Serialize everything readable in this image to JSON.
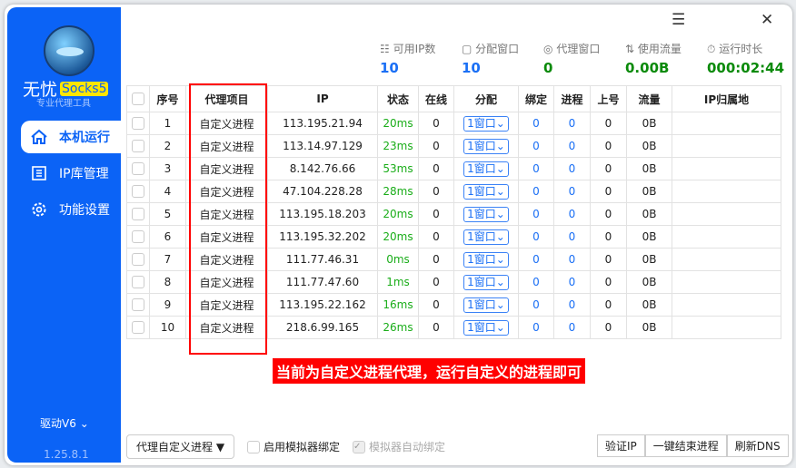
{
  "sidebar": {
    "brand": "无忧",
    "brand_tag": "Socks5",
    "subtitle": "专业代理工具",
    "items": [
      {
        "label": "本机运行",
        "icon": "home-icon"
      },
      {
        "label": "IP库管理",
        "icon": "list-icon"
      },
      {
        "label": "功能设置",
        "icon": "gear-icon"
      }
    ],
    "driver": "驱动V6",
    "version": "1.25.8.1"
  },
  "stats": [
    {
      "label": "可用IP数",
      "value": "10",
      "color": "#1a6ff5",
      "icon": "list-icon"
    },
    {
      "label": "分配窗口",
      "value": "10",
      "color": "#1a6ff5",
      "icon": "window-icon"
    },
    {
      "label": "代理窗口",
      "value": "0",
      "color": "#0a8a0a",
      "icon": "proxy-icon"
    },
    {
      "label": "使用流量",
      "value": "0.00B",
      "color": "#0a8a0a",
      "icon": "updown-icon"
    },
    {
      "label": "运行时长",
      "value": "000:02:44",
      "color": "#0a8a0a",
      "icon": "timer-icon"
    }
  ],
  "table": {
    "headers": [
      "",
      "序号",
      "代理项目",
      "IP",
      "状态",
      "在线",
      "分配",
      "绑定",
      "进程",
      "上号",
      "流量",
      "IP归属地"
    ],
    "rows": [
      [
        "1",
        "自定义进程",
        "113.195.21.94",
        "20ms",
        "0",
        "1窗口",
        "0",
        "0",
        "0",
        "0B",
        ""
      ],
      [
        "2",
        "自定义进程",
        "113.14.97.129",
        "23ms",
        "0",
        "1窗口",
        "0",
        "0",
        "0",
        "0B",
        ""
      ],
      [
        "3",
        "自定义进程",
        "8.142.76.66",
        "53ms",
        "0",
        "1窗口",
        "0",
        "0",
        "0",
        "0B",
        ""
      ],
      [
        "4",
        "自定义进程",
        "47.104.228.28",
        "28ms",
        "0",
        "1窗口",
        "0",
        "0",
        "0",
        "0B",
        ""
      ],
      [
        "5",
        "自定义进程",
        "113.195.18.203",
        "20ms",
        "0",
        "1窗口",
        "0",
        "0",
        "0",
        "0B",
        ""
      ],
      [
        "6",
        "自定义进程",
        "113.195.32.202",
        "20ms",
        "0",
        "1窗口",
        "0",
        "0",
        "0",
        "0B",
        ""
      ],
      [
        "7",
        "自定义进程",
        "111.77.46.31",
        "0ms",
        "0",
        "1窗口",
        "0",
        "0",
        "0",
        "0B",
        ""
      ],
      [
        "8",
        "自定义进程",
        "111.77.47.60",
        "1ms",
        "0",
        "1窗口",
        "0",
        "0",
        "0",
        "0B",
        ""
      ],
      [
        "9",
        "自定义进程",
        "113.195.22.162",
        "16ms",
        "0",
        "1窗口",
        "0",
        "0",
        "0",
        "0B",
        ""
      ],
      [
        "10",
        "自定义进程",
        "218.6.99.165",
        "26ms",
        "0",
        "1窗口",
        "0",
        "0",
        "0",
        "0B",
        ""
      ]
    ]
  },
  "annotation": "当前为自定义进程代理，运行自定义的进程即可",
  "footer": {
    "mode": "代理自定义进程",
    "enable_bind": "启用模拟器绑定",
    "auto_bind": "模拟器自动绑定",
    "verify": "验证IP",
    "kill": "一键结束进程",
    "dns": "刷新DNS"
  }
}
